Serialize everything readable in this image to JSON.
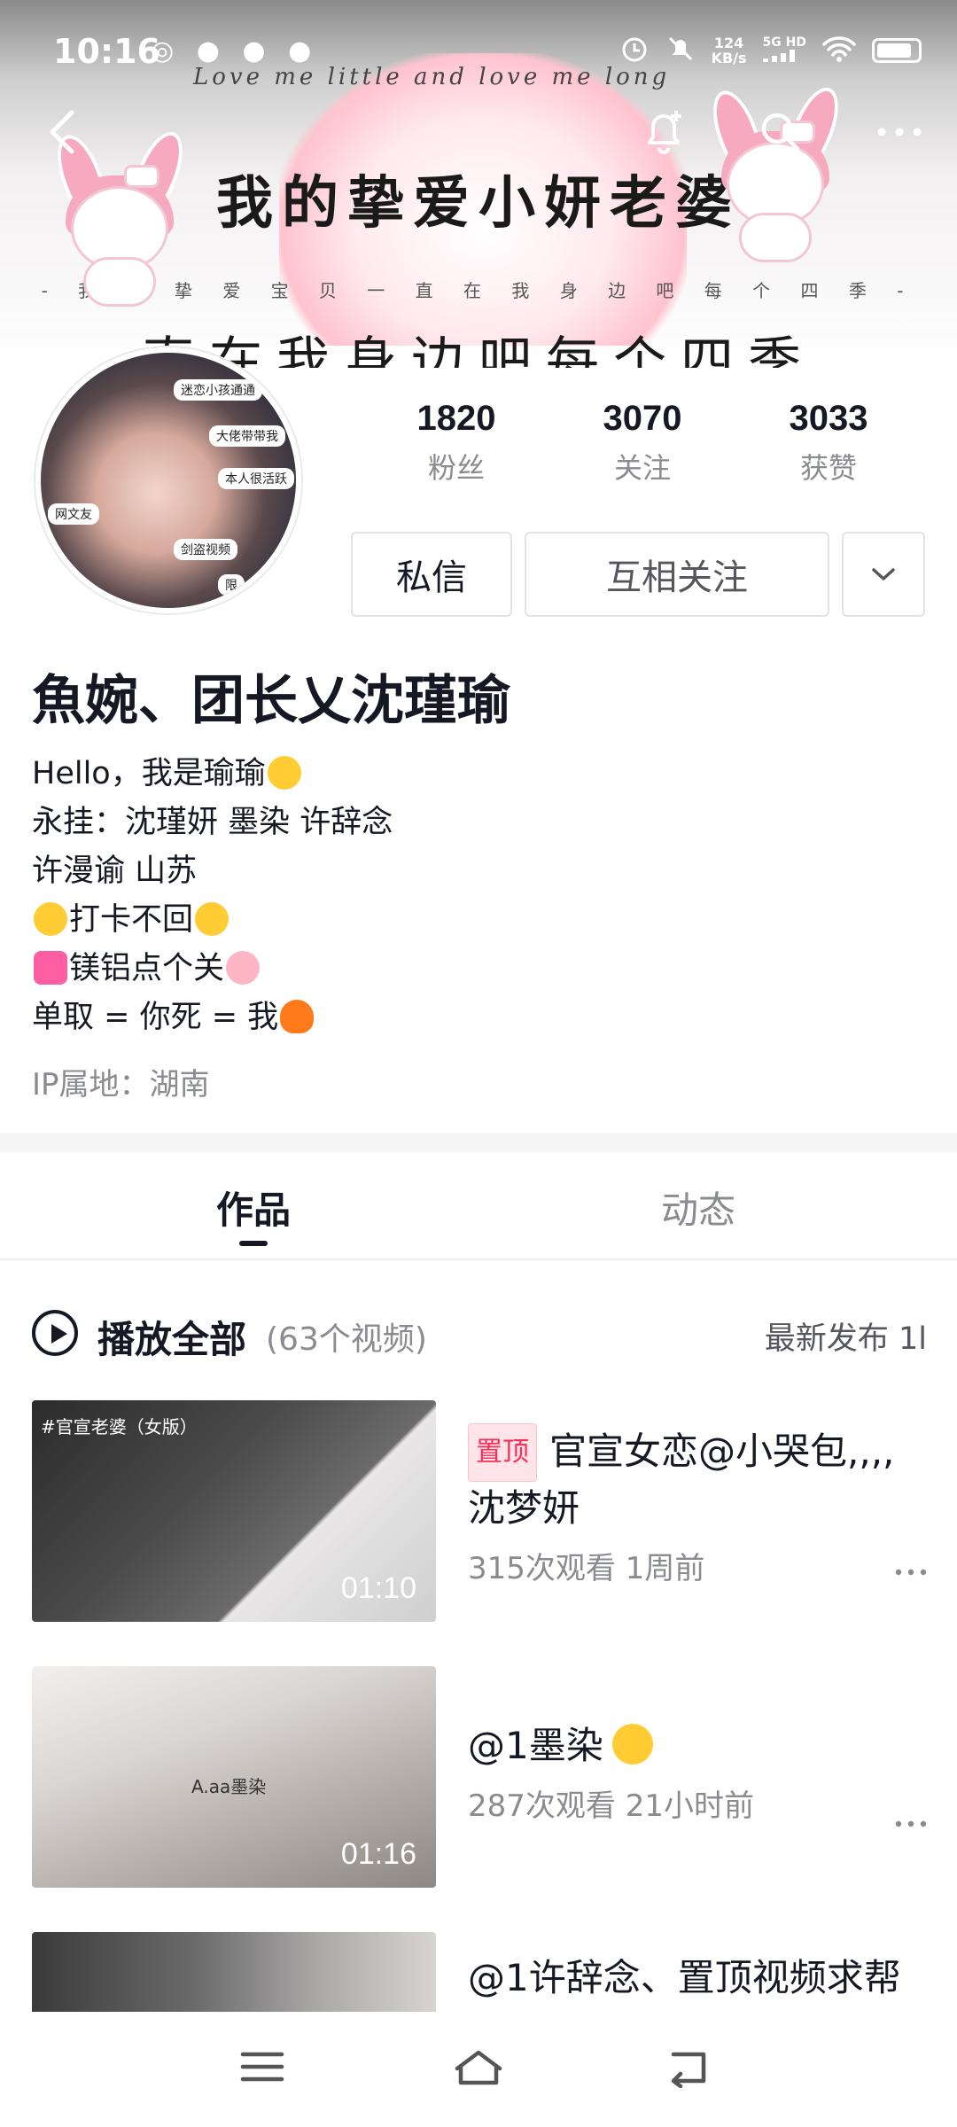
{
  "status_bar": {
    "time": "10:16",
    "left_icons": "◎ ● ● ●",
    "net_speed_value": "124",
    "net_speed_unit": "KB/s",
    "network": "5G HD"
  },
  "banner": {
    "script_text": "Love me little and love me long",
    "title": "我的挚爱小妍老婆",
    "subtitle": "- 我 的 挚 爱 宝 贝 一 直 在 我 身 边 吧 每 个 四 季 -",
    "big_text": "直在我身边吧每个四季"
  },
  "avatar": {
    "tags": [
      "迷恋小孩通通",
      "大佬带带我",
      "本人很活跃",
      "剑盗视频",
      "网文友",
      "限"
    ]
  },
  "stats": [
    {
      "value": "1820",
      "label": "粉丝"
    },
    {
      "value": "3070",
      "label": "关注"
    },
    {
      "value": "3033",
      "label": "获赞"
    }
  ],
  "actions": {
    "message": "私信",
    "mutual_follow": "互相关注"
  },
  "profile": {
    "nickname": "魚婉、团长乂沈瑾瑜",
    "bio": {
      "line1": "Hello，我是瑜瑜",
      "line2": "永挂：沈瑾妍  墨染   许辞念",
      "line3": "许漫谕  山苏",
      "line4": "打卡不回",
      "line5": "镁铝点个关",
      "line6": "单取 = 你死 = 我"
    },
    "ip_location": "IP属地：湖南"
  },
  "tabs": {
    "works": "作品",
    "dynamic": "动态"
  },
  "play_all": {
    "label": "播放全部",
    "count": "(63个视频)",
    "sort": "最新发布 1l"
  },
  "videos": [
    {
      "pinned": "置顶",
      "title": "官宣女恋@小哭包,,,, 沈梦妍",
      "meta": "315次观看  1周前",
      "duration": "01:10",
      "overlay": "#官宣老婆（女版）"
    },
    {
      "pinned": "",
      "title": "@1墨染",
      "meta": "287次观看  21小时前",
      "duration": "01:16",
      "overlay": "A.aa墨染"
    },
    {
      "pinned": "",
      "title": "@1许辞念、置顶视频求帮",
      "meta": "",
      "duration": "",
      "overlay": ""
    }
  ],
  "colors": {
    "accent_pink": "#fe2c55",
    "text_primary": "#161823",
    "text_secondary": "#8a8b91"
  }
}
